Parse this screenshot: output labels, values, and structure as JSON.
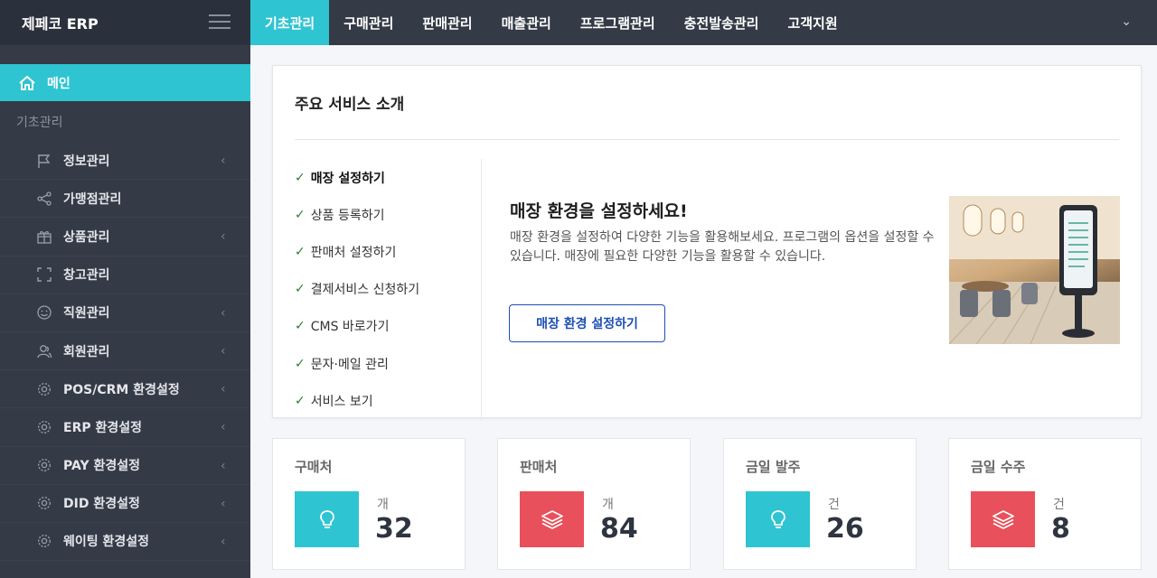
{
  "app": {
    "title": "제페코 ERP"
  },
  "topnav": {
    "tabs": [
      "기초관리",
      "구매관리",
      "판매관리",
      "매출관리",
      "프로그램관리",
      "충전발송관리",
      "고객지원"
    ],
    "active_tab": "기초관리",
    "dropdown_icon": "chevron-down-icon"
  },
  "sidebar": {
    "main_label": "메인",
    "section_header": "기초관리",
    "items": [
      {
        "label": "정보관리",
        "icon": "flag-icon",
        "has_chevron": true
      },
      {
        "label": "가맹점관리",
        "icon": "share-icon",
        "has_chevron": false
      },
      {
        "label": "상품관리",
        "icon": "gift-icon",
        "has_chevron": true
      },
      {
        "label": "창고관리",
        "icon": "frame-icon",
        "has_chevron": false
      },
      {
        "label": "직원관리",
        "icon": "smile-icon",
        "has_chevron": true
      },
      {
        "label": "회원관리",
        "icon": "users-icon",
        "has_chevron": true
      },
      {
        "label": "POS/CRM 환경설정",
        "icon": "gear-icon",
        "has_chevron": true
      },
      {
        "label": "ERP 환경설정",
        "icon": "gear-icon",
        "has_chevron": true
      },
      {
        "label": "PAY 환경설정",
        "icon": "gear-icon",
        "has_chevron": true
      },
      {
        "label": "DID 환경설정",
        "icon": "gear-icon",
        "has_chevron": true
      },
      {
        "label": "웨이팅 환경설정",
        "icon": "gear-icon",
        "has_chevron": true
      }
    ]
  },
  "intro": {
    "title": "주요 서비스 소개",
    "services": [
      {
        "label": "매장 설정하기",
        "active": true
      },
      {
        "label": "상품 등록하기",
        "active": false
      },
      {
        "label": "판매처 설정하기",
        "active": false
      },
      {
        "label": "결제서비스 신청하기",
        "active": false
      },
      {
        "label": "CMS 바로가기",
        "active": false
      },
      {
        "label": "문자·메일 관리",
        "active": false
      },
      {
        "label": "서비스 보기",
        "active": false
      }
    ],
    "feature_title": "매장 환경을 설정하세요!",
    "feature_desc": "매장 환경을 설정하여 다양한 기능을 활용해보세요. 프로그램의 옵션을 설정할 수 있습니다. 매장에 필요한 다양한 기능을 활용할 수 있습니다.",
    "feature_button": "매장 환경 설정하기"
  },
  "stats": [
    {
      "title": "구매처",
      "unit": "개",
      "value": "32",
      "icon": "lightbulb-icon",
      "color": "#2fc4d2"
    },
    {
      "title": "판매처",
      "unit": "개",
      "value": "84",
      "icon": "layers-icon",
      "color": "#e8505b"
    },
    {
      "title": "금일 발주",
      "unit": "건",
      "value": "26",
      "icon": "lightbulb-icon",
      "color": "#2fc4d2"
    },
    {
      "title": "금일 수주",
      "unit": "건",
      "value": "8",
      "icon": "layers-icon",
      "color": "#e8505b"
    }
  ]
}
